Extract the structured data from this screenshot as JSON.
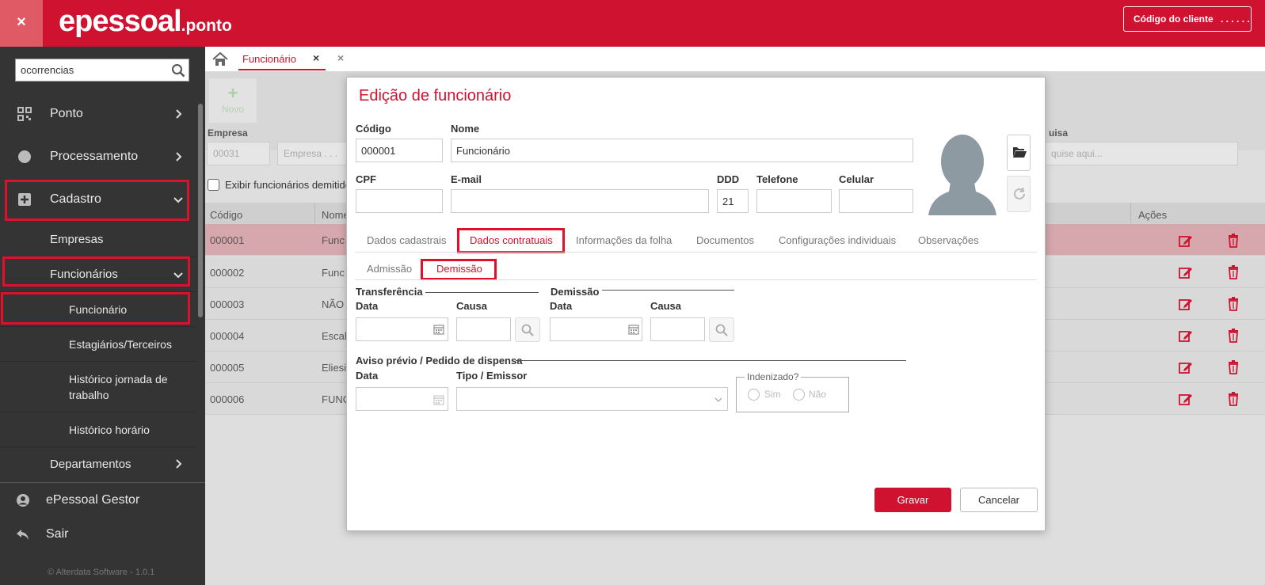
{
  "header": {
    "close_label": "×",
    "logo_main": "epessoal",
    "logo_sub": ".ponto",
    "client_code_label": "Código do cliente",
    "client_code_value": ". . . .  . ."
  },
  "sidebar": {
    "search_value": "ocorrencias",
    "items": [
      {
        "label": "Ponto",
        "icon": "qrcode-icon"
      },
      {
        "label": "Processamento",
        "icon": "circle-icon"
      },
      {
        "label": "Cadastro",
        "icon": "plus-square-icon"
      }
    ],
    "submenu": {
      "empresas": "Empresas",
      "funcionarios": "Funcionários",
      "funcionario": "Funcionário",
      "estagiarios": "Estagiários/Terceiros",
      "historico_jornada": "Histórico jornada de trabalho",
      "historico_horario": "Histórico horário",
      "departamentos": "Departamentos"
    },
    "footer": {
      "gestor": "ePessoal Gestor",
      "sair": "Sair",
      "copyright": "© Alterdata Software - 1.0.1"
    }
  },
  "tabs": {
    "active": "Funcionário",
    "close_symbol": "×"
  },
  "background_page": {
    "novo_label": "Novo",
    "empresa_label": "Empresa",
    "empresa_code": "00031",
    "empresa_name": "Empresa . . .",
    "pesquisa_label": "uisa",
    "pesquisa_placeholder": "quise aqui...",
    "exibir_demitidos": "Exibir funcionários demitido",
    "columns": {
      "codigo": "Código",
      "nome": "Nome",
      "acoes": "Ações"
    },
    "rows": [
      {
        "codigo": "000001",
        "nome": "Func"
      },
      {
        "codigo": "000002",
        "nome": "Func"
      },
      {
        "codigo": "000003",
        "nome": "NÃO A"
      },
      {
        "codigo": "000004",
        "nome": "Escal"
      },
      {
        "codigo": "000005",
        "nome": "Eliesi"
      },
      {
        "codigo": "000006",
        "nome": "FUNC"
      }
    ]
  },
  "modal": {
    "title": "Edição de funcionário",
    "labels": {
      "codigo": "Código",
      "nome": "Nome",
      "cpf": "CPF",
      "email": "E-mail",
      "ddd": "DDD",
      "telefone": "Telefone",
      "celular": "Celular"
    },
    "values": {
      "codigo": "000001",
      "nome": "Funcionário",
      "cpf": "",
      "email": "",
      "ddd": "21",
      "telefone": "",
      "celular": ""
    },
    "tabs": [
      "Dados cadastrais",
      "Dados contratuais",
      "Informações da folha",
      "Documentos",
      "Configurações individuais",
      "Observações"
    ],
    "subtabs": [
      "Admissão",
      "Demissão"
    ],
    "sections": {
      "transferencia": "Transferência",
      "demissao": "Demissão",
      "aviso": "Aviso prévio / Pedido de dispensa"
    },
    "fields": {
      "data": "Data",
      "causa": "Causa",
      "tipo_emissor": "Tipo / Emissor",
      "indenizado": "Indenizado?",
      "sim": "Sim",
      "nao": "Não"
    },
    "buttons": {
      "gravar": "Gravar",
      "cancelar": "Cancelar"
    },
    "colors": {
      "accent": "#cf1230",
      "highlight": "#e0102a"
    }
  }
}
